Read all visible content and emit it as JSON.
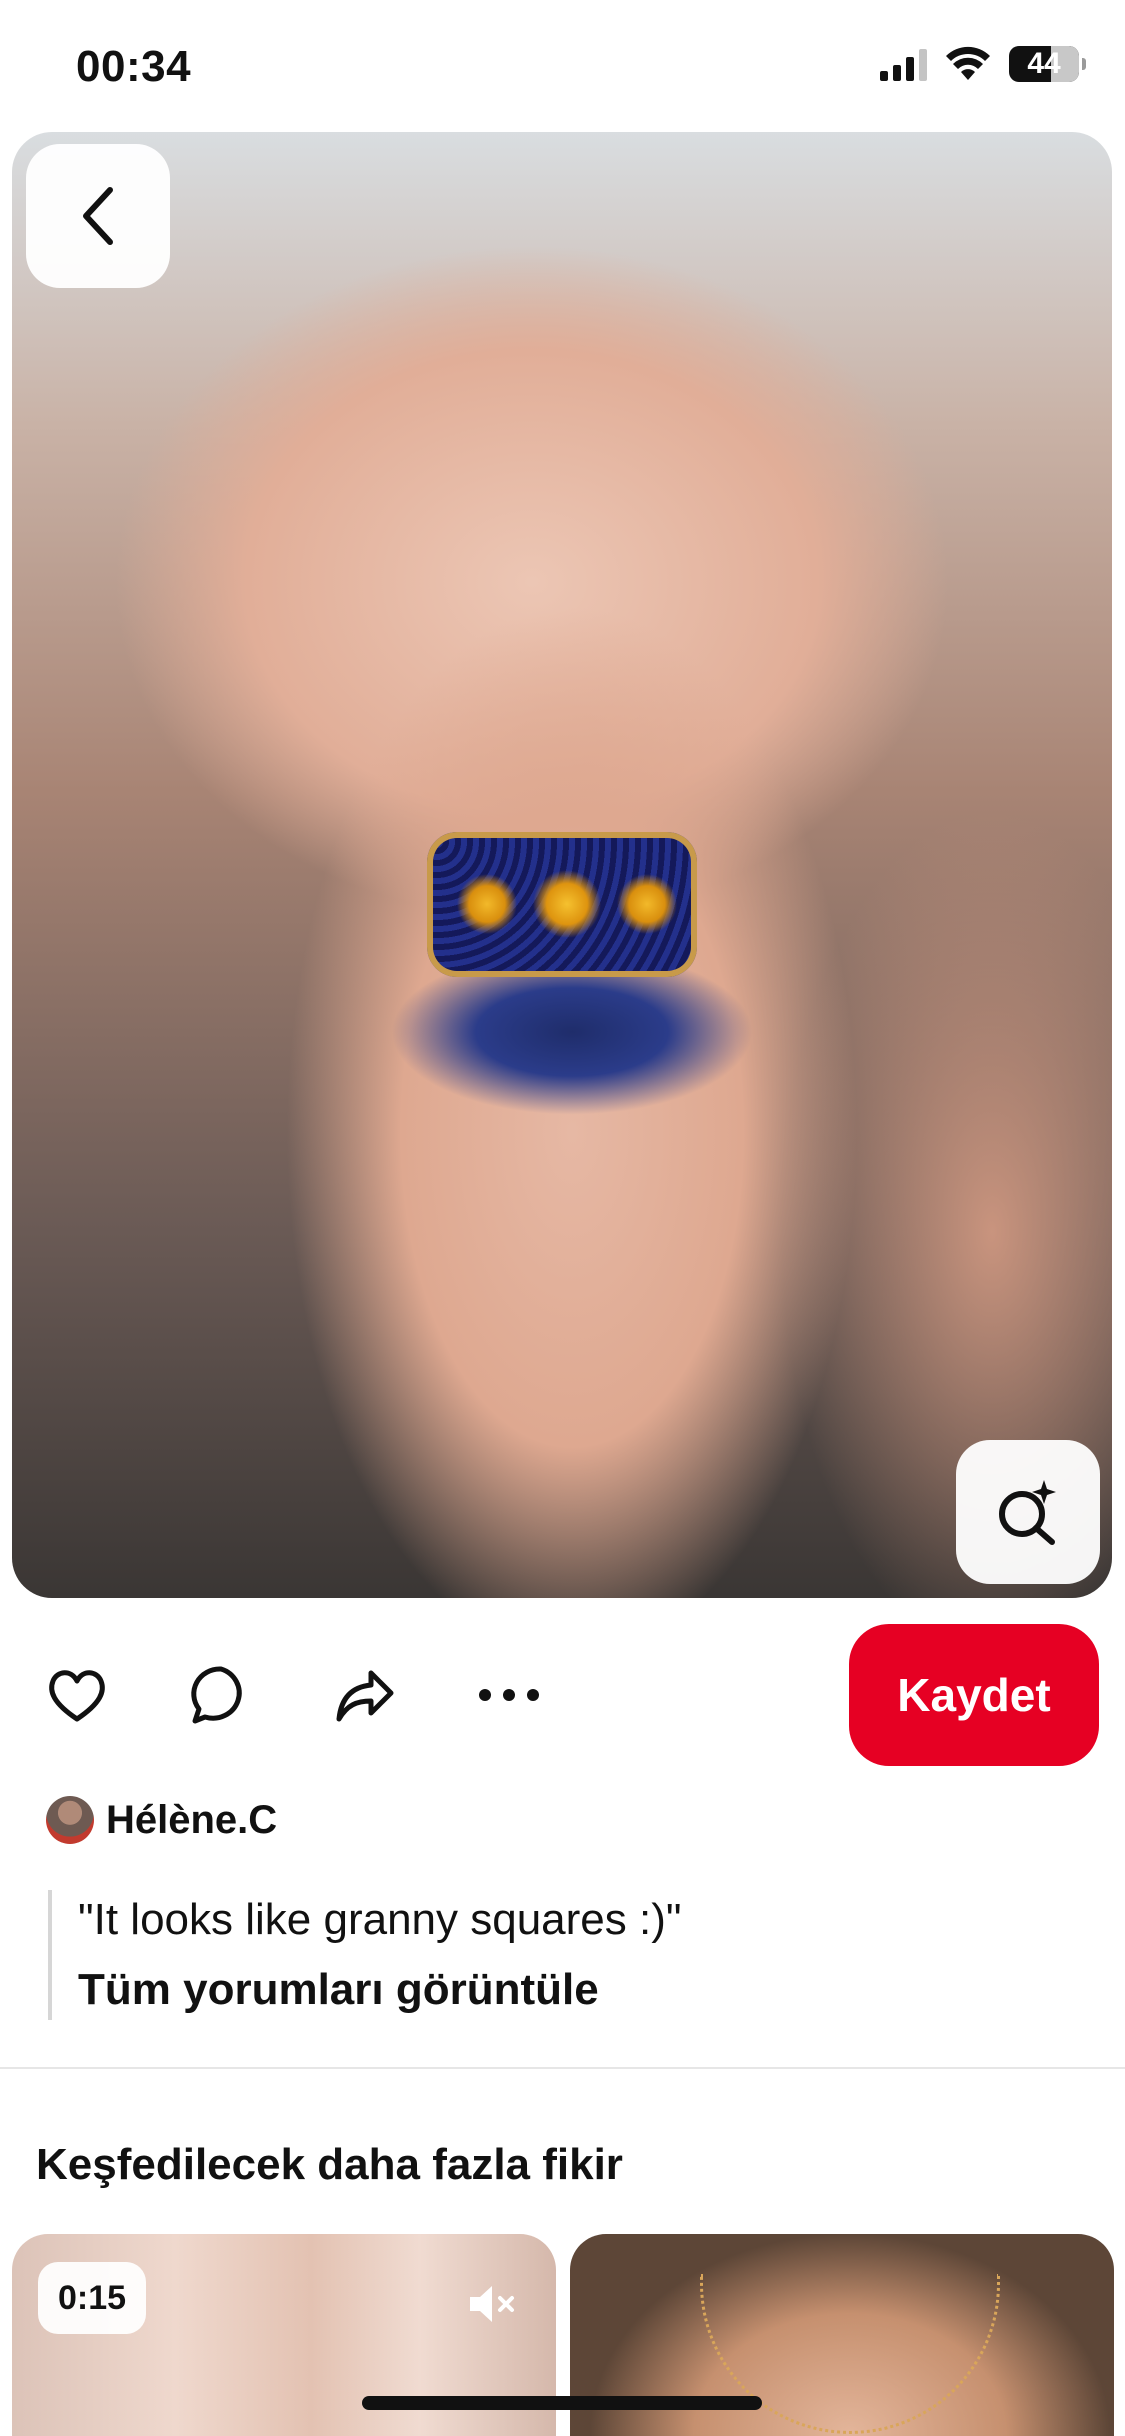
{
  "status_bar": {
    "time": "00:34",
    "battery": "44"
  },
  "actions": {
    "save_label": "Kaydet"
  },
  "author": {
    "name": "Hélène.C"
  },
  "comment": {
    "text": "\"It looks like granny squares :)\"",
    "view_all": "Tüm yorumları görüntüle"
  },
  "more_ideas": {
    "title": "Keşfedilecek daha fazla fikir",
    "items": [
      {
        "duration": "0:15",
        "icon": "mute-icon"
      },
      {
        "icon": "none"
      }
    ]
  },
  "colors": {
    "accent": "#e60023",
    "text": "#111111"
  }
}
